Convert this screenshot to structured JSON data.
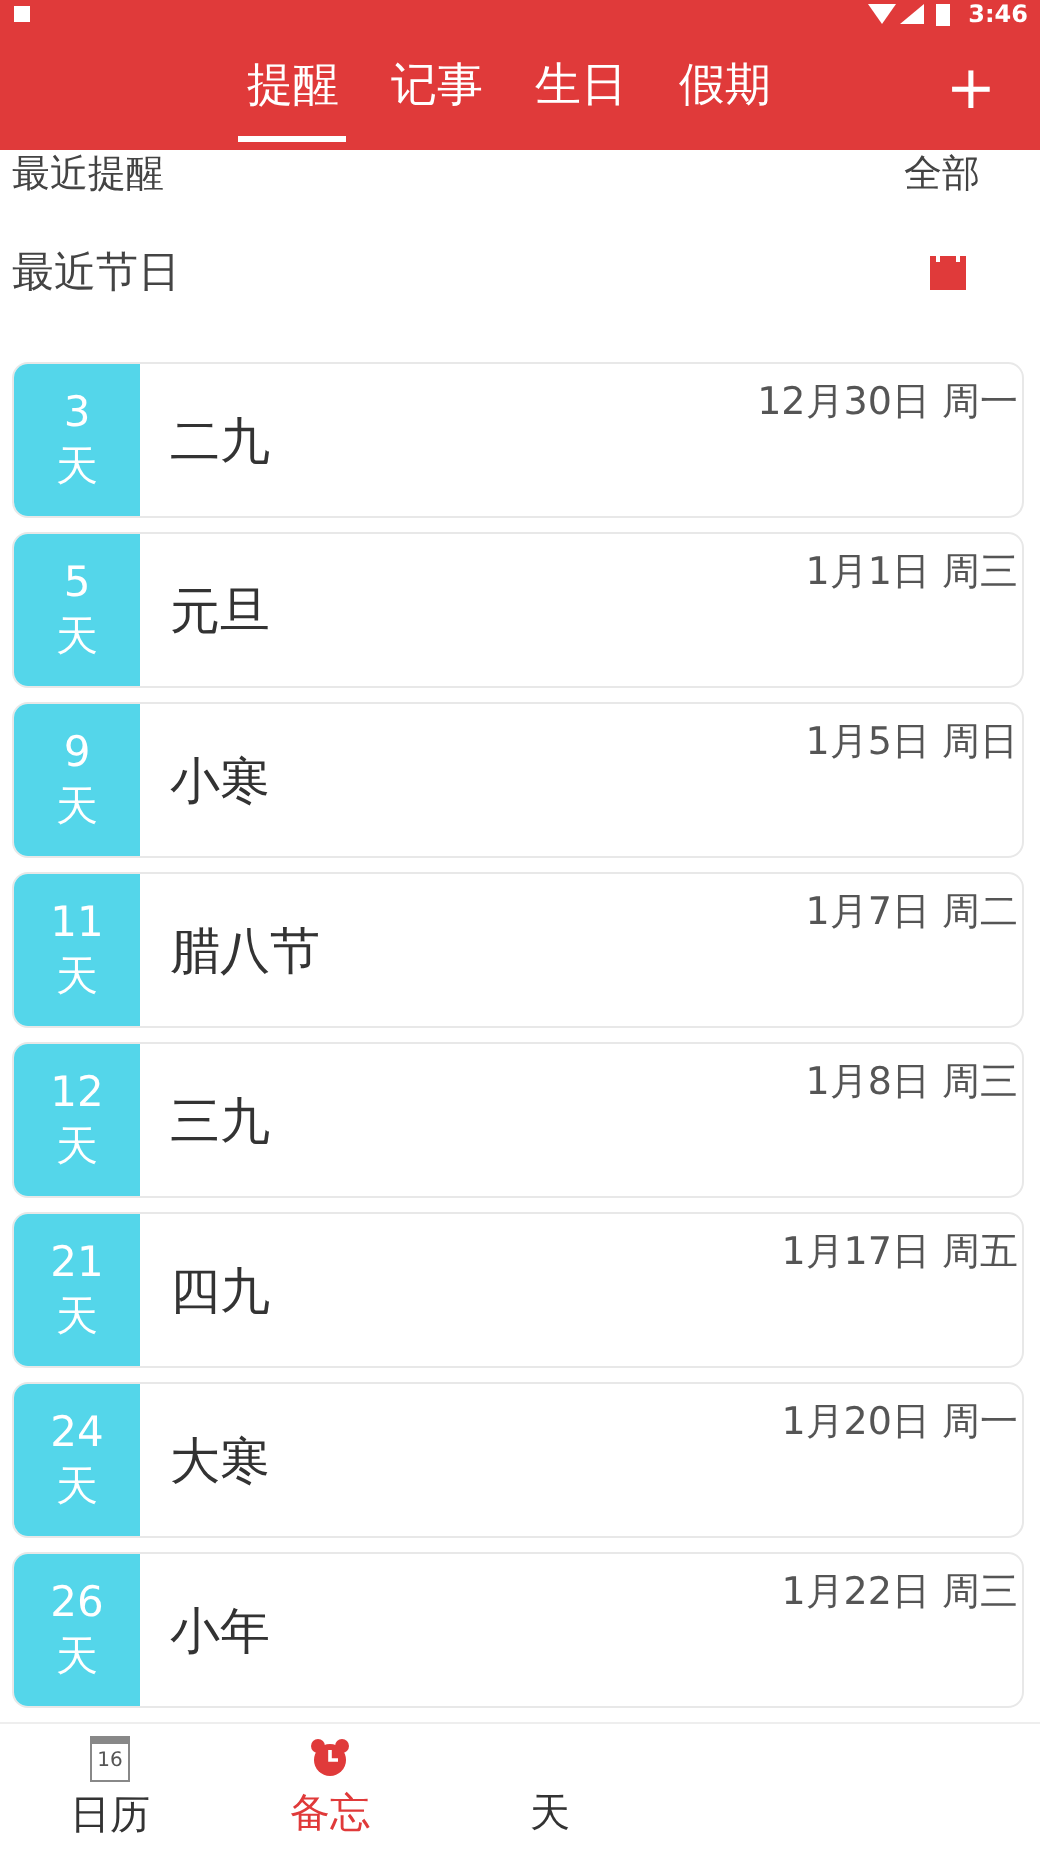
{
  "status_bar": {
    "time": "3:46"
  },
  "tabs": [
    {
      "label": "提醒",
      "selected": true
    },
    {
      "label": "记事",
      "selected": false
    },
    {
      "label": "生日",
      "selected": false
    },
    {
      "label": "假期",
      "selected": false
    }
  ],
  "add_button": "+",
  "recent_reminders": {
    "title": "最近提醒",
    "link": "全部"
  },
  "recent_holidays": {
    "title": "最近节日"
  },
  "holidays": [
    {
      "days": "3",
      "unit": "天",
      "name": "二九",
      "date": "12月30日 周一"
    },
    {
      "days": "5",
      "unit": "天",
      "name": "元旦",
      "date": "1月1日 周三"
    },
    {
      "days": "9",
      "unit": "天",
      "name": "小寒",
      "date": "1月5日 周日"
    },
    {
      "days": "11",
      "unit": "天",
      "name": "腊八节",
      "date": "1月7日 周二"
    },
    {
      "days": "12",
      "unit": "天",
      "name": "三九",
      "date": "1月8日 周三"
    },
    {
      "days": "21",
      "unit": "天",
      "name": "四九",
      "date": "1月17日 周五"
    },
    {
      "days": "24",
      "unit": "天",
      "name": "大寒",
      "date": "1月20日 周一"
    },
    {
      "days": "26",
      "unit": "天",
      "name": "小年",
      "date": "1月22日 周三"
    }
  ],
  "bottom_nav": [
    {
      "label": "日历",
      "kind": "calendar",
      "selected": false,
      "icon_text": "16"
    },
    {
      "label": "备忘",
      "kind": "alarm",
      "selected": true
    },
    {
      "label": "天",
      "kind": "none",
      "selected": false
    }
  ]
}
